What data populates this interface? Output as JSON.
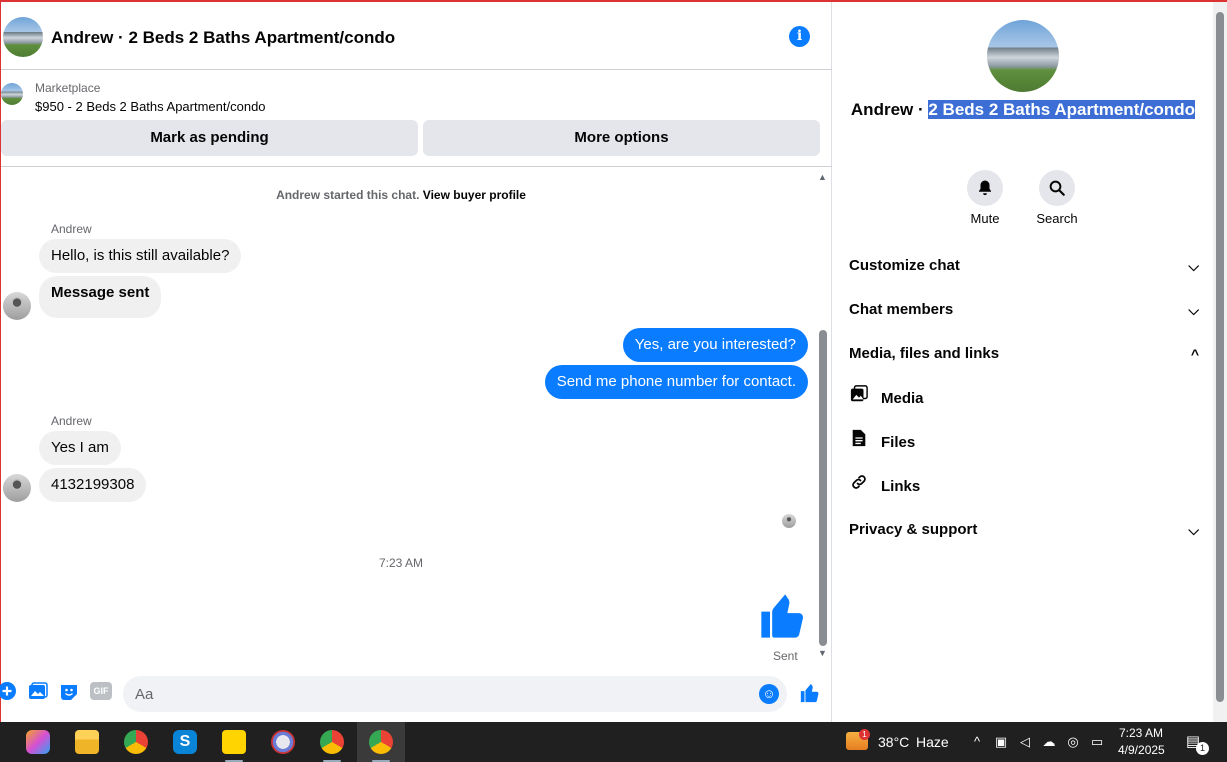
{
  "chat": {
    "title": "Andrew · 2 Beds 2 Baths Apartment/condo",
    "marketplace": {
      "label": "Marketplace",
      "listing": "$950 - 2 Beds 2 Baths Apartment/condo",
      "mark_pending": "Mark as pending",
      "more_options": "More options"
    },
    "started_text": "Andrew started this chat.",
    "view_profile": "View buyer profile",
    "messages": [
      {
        "sender": "Andrew",
        "text": "Hello, is this still available?"
      },
      {
        "text": "Message sent"
      },
      {
        "text": "Yes, are you interested?"
      },
      {
        "text": "Send me phone number for contact."
      },
      {
        "sender": "Andrew",
        "text": "Yes I am"
      },
      {
        "text": "4132199308"
      }
    ],
    "time_separator": "7:23 AM",
    "sent_status": "Sent",
    "composer_placeholder": "Aa",
    "gif_label": "GIF"
  },
  "info": {
    "name_prefix": "Andrew ·",
    "name_highlight": "2 Beds 2 Baths Apartment/condo",
    "mute_label": "Mute",
    "search_label": "Search",
    "sections": {
      "customize": "Customize chat",
      "members": "Chat members",
      "media_files_links": "Media, files and links",
      "media": "Media",
      "files": "Files",
      "links": "Links",
      "privacy": "Privacy & support"
    }
  },
  "taskbar": {
    "weather_temp": "38°C",
    "weather_desc": "Haze",
    "weather_badge": "1",
    "time": "7:23 AM",
    "date": "4/9/2025",
    "notification_count": "1"
  },
  "colors": {
    "accent": "#0a7cff",
    "highlight": "#3d6ed5",
    "taskbar": "#202020"
  }
}
